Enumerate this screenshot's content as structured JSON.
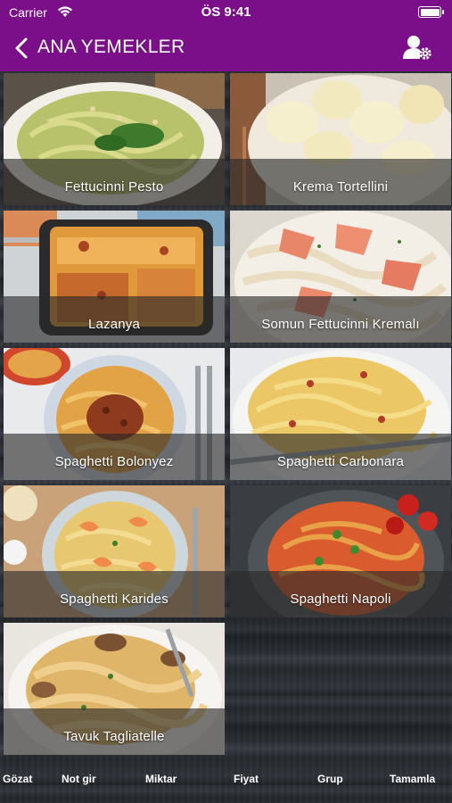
{
  "status": {
    "carrier": "Carrier",
    "time": "ÖS 9:41"
  },
  "nav": {
    "title": "ANA YEMEKLER",
    "back_icon": "chevron-left-icon",
    "action_icon": "user-settings-icon"
  },
  "colors": {
    "brand": "#7b0f8a",
    "caption_band": "rgba(40,40,40,0.62)"
  },
  "dishes": [
    {
      "name": "Fettucinni Pesto"
    },
    {
      "name": "Krema Tortellini"
    },
    {
      "name": "Lazanya"
    },
    {
      "name": "Somun Fettucinni Kremalı"
    },
    {
      "name": "Spaghetti Bolonyez"
    },
    {
      "name": "Spaghetti Carbonara"
    },
    {
      "name": "Spaghetti Karides"
    },
    {
      "name": "Spaghetti Napoli"
    },
    {
      "name": "Tavuk Tagliatelle"
    }
  ],
  "tabs": [
    {
      "label": "Gözat"
    },
    {
      "label": "Not gir"
    },
    {
      "label": "Miktar"
    },
    {
      "label": "Fiyat"
    },
    {
      "label": "Grup"
    },
    {
      "label": "Tamamla"
    }
  ]
}
